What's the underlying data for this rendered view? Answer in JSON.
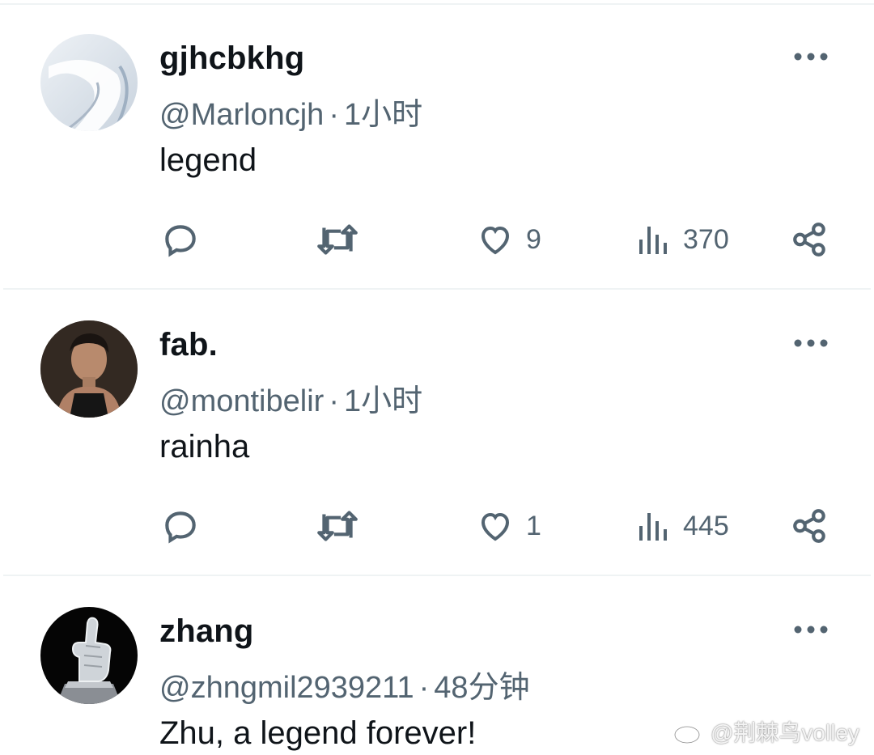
{
  "posts": [
    {
      "name": "gjhcbkhg",
      "handle": "@Marloncjh",
      "time": "1小时",
      "text": "legend",
      "likes": "9",
      "views": "370"
    },
    {
      "name": "fab.",
      "handle": "@montibelir",
      "time": "1小时",
      "text": "rainha",
      "likes": "1",
      "views": "445"
    },
    {
      "name": "zhang",
      "handle": "@zhngmil2939211",
      "time": "48分钟",
      "text": "Zhu, a legend forever!"
    }
  ],
  "separator": "·",
  "watermark": "@荆棘鸟volley",
  "icons": {
    "more": "more-horizontal-icon",
    "reply": "reply-bubble-icon",
    "retweet": "retweet-icon",
    "like": "heart-icon",
    "views": "views-bar-chart-icon",
    "share": "share-icon",
    "watermark": "weibo-logo-icon"
  },
  "colors": {
    "text": "#0f1419",
    "secondary": "#536471",
    "divider": "#eff3f4"
  }
}
